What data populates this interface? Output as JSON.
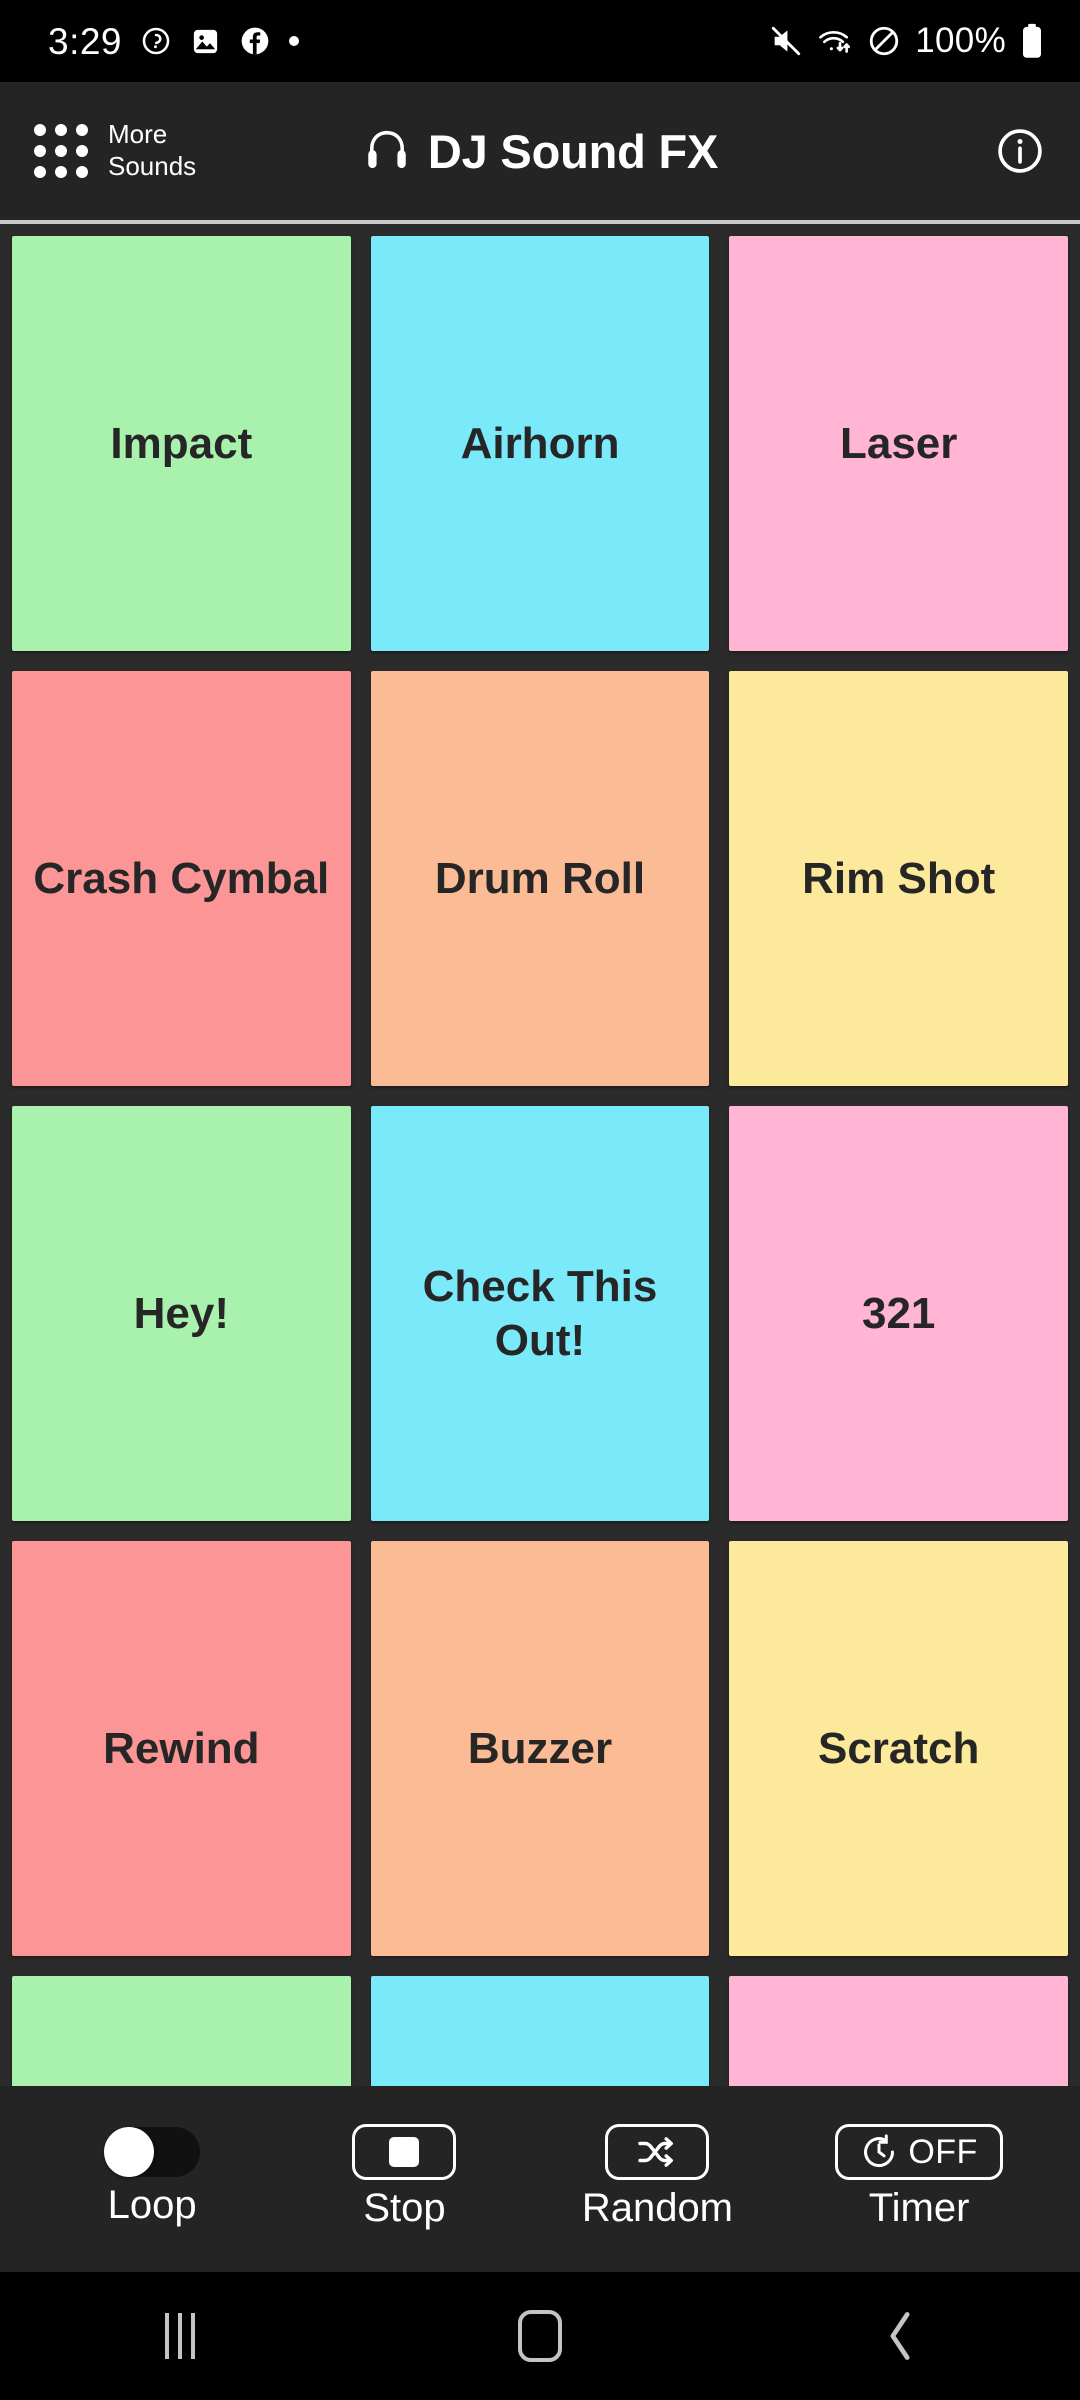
{
  "status_bar": {
    "time": "3:29",
    "left_icons": [
      "clock-refresh-icon",
      "photo-icon",
      "facebook-icon",
      "dot-indicator"
    ],
    "right_icons": [
      "mute-icon",
      "wifi-icon",
      "do-not-disturb-icon",
      "battery-icon"
    ],
    "battery_percent": "100%"
  },
  "header": {
    "more_sounds_line1": "More",
    "more_sounds_line2": "Sounds",
    "grid_icon": "apps-grid-icon",
    "headphones_icon": "headphones-icon",
    "title": "DJ Sound FX",
    "info_icon": "info-icon"
  },
  "colors": {
    "background": "#2b2b2b",
    "appbar": "#242424",
    "green": "#a8f2ae",
    "cyan": "#7aeafb",
    "pink": "#ffb5d3",
    "salmon": "#fc9595",
    "peach": "#fbbb95",
    "yellow": "#fce99b",
    "pad_text": "#262626"
  },
  "pads": [
    [
      {
        "label": "Impact",
        "color": "#a8f2ae"
      },
      {
        "label": "Airhorn",
        "color": "#7aeafb"
      },
      {
        "label": "Laser",
        "color": "#ffb5d3"
      }
    ],
    [
      {
        "label": "Crash Cymbal",
        "color": "#fc9595"
      },
      {
        "label": "Drum Roll",
        "color": "#fbbb95"
      },
      {
        "label": "Rim Shot",
        "color": "#fce99b"
      }
    ],
    [
      {
        "label": "Hey!",
        "color": "#a8f2ae"
      },
      {
        "label": "Check This Out!",
        "color": "#7aeafb"
      },
      {
        "label": "321",
        "color": "#ffb5d3"
      }
    ],
    [
      {
        "label": "Rewind",
        "color": "#fc9595"
      },
      {
        "label": "Buzzer",
        "color": "#fbbb95"
      },
      {
        "label": "Scratch",
        "color": "#fce99b"
      }
    ],
    [
      {
        "label": "",
        "color": "#a8f2ae"
      },
      {
        "label": "",
        "color": "#7aeafb"
      },
      {
        "label": "",
        "color": "#ffb5d3"
      }
    ]
  ],
  "controls": {
    "loop": {
      "label": "Loop",
      "state": "off",
      "icon": "toggle-switch-icon"
    },
    "stop": {
      "label": "Stop",
      "icon": "stop-square-icon"
    },
    "random": {
      "label": "Random",
      "icon": "shuffle-icon"
    },
    "timer": {
      "label": "Timer",
      "value": "OFF",
      "icon": "timer-icon"
    }
  },
  "nav_bar": {
    "recents": "recents-icon",
    "home": "home-icon",
    "back": "back-icon"
  }
}
